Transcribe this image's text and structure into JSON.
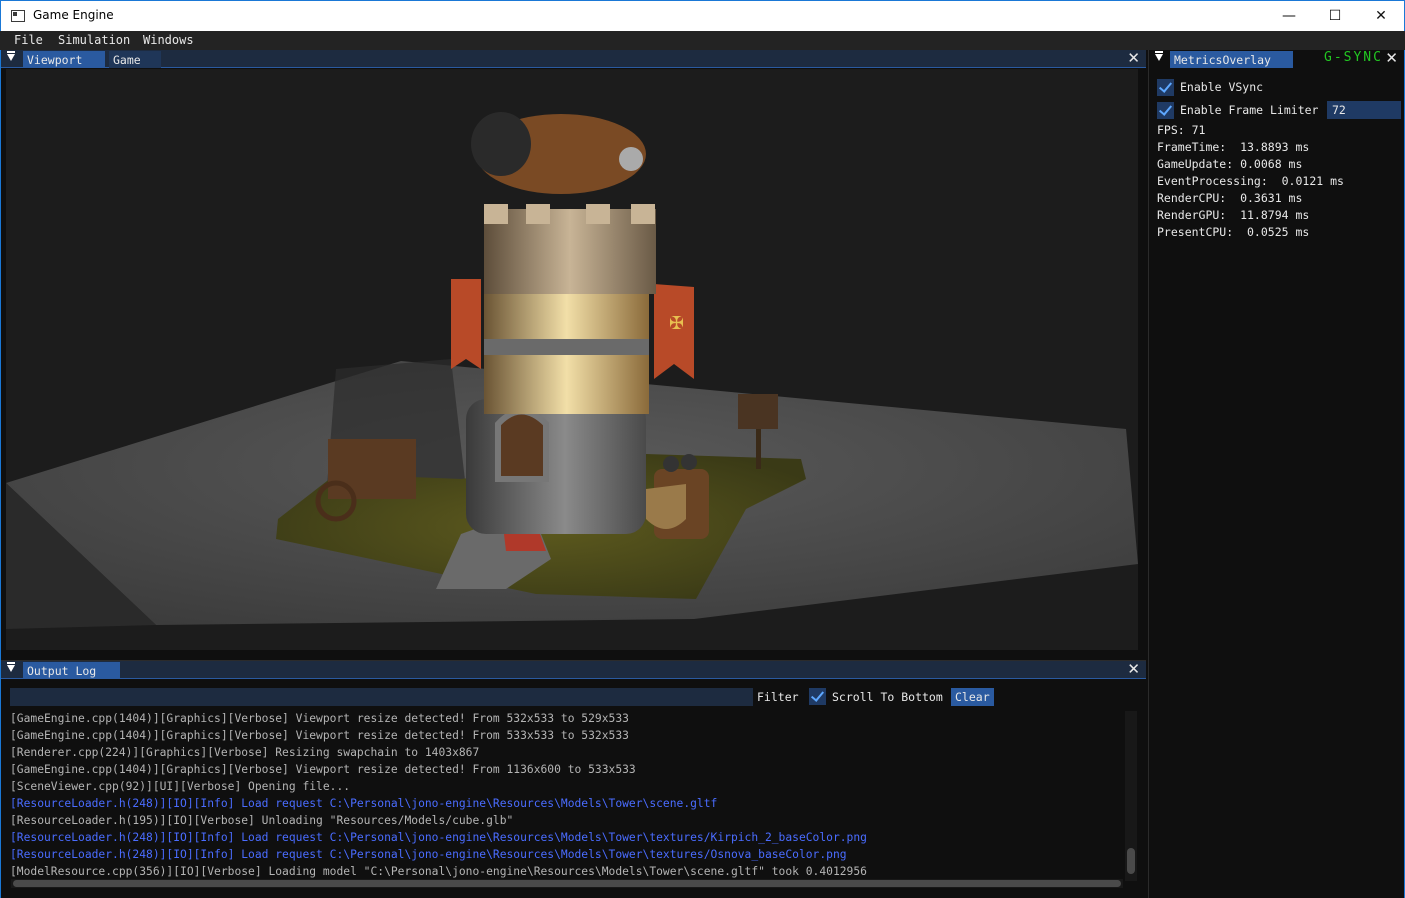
{
  "window": {
    "title": "Game Engine",
    "buttons": {
      "minimize": "—",
      "maximize": "☐",
      "close": "✕"
    }
  },
  "menu": {
    "items": [
      "File",
      "Simulation",
      "Windows"
    ]
  },
  "viewport_panel": {
    "tabs": [
      "Viewport",
      "Game"
    ],
    "active_tab": "Viewport",
    "close": "✕"
  },
  "metrics_panel": {
    "tab": "MetricsOverlay",
    "badge": "G-SYNC",
    "close": "✕",
    "vsync_label": "Enable VSync",
    "vsync_checked": true,
    "frame_limiter_label": "Enable Frame Limiter",
    "frame_limiter_checked": true,
    "frame_limit_value": "72",
    "metrics": [
      "FPS: 71",
      "FrameTime:  13.8893 ms",
      "GameUpdate: 0.0068 ms",
      "EventProcessing:  0.0121 ms",
      "RenderCPU:  0.3631 ms",
      "RenderGPU:  11.8794 ms",
      "PresentCPU:  0.0525 ms"
    ]
  },
  "log_panel": {
    "tab": "Output Log",
    "close": "✕",
    "filter_value": "",
    "filter_label": "Filter",
    "scroll_label": "Scroll To Bottom",
    "scroll_checked": true,
    "clear_label": "Clear",
    "colors": {
      "verbose": "#b4b4b4",
      "info": "#4a6cff"
    },
    "lines": [
      {
        "level": "verbose",
        "text": "[GameEngine.cpp(1404)][Graphics][Verbose] Viewport resize detected! From 532x533 to 529x533"
      },
      {
        "level": "verbose",
        "text": "[GameEngine.cpp(1404)][Graphics][Verbose] Viewport resize detected! From 533x533 to 532x533"
      },
      {
        "level": "verbose",
        "text": "[Renderer.cpp(224)][Graphics][Verbose] Resizing swapchain to 1403x867"
      },
      {
        "level": "verbose",
        "text": "[GameEngine.cpp(1404)][Graphics][Verbose] Viewport resize detected! From 1136x600 to 533x533"
      },
      {
        "level": "verbose",
        "text": "[SceneViewer.cpp(92)][UI][Verbose] Opening file..."
      },
      {
        "level": "info",
        "text": "[ResourceLoader.h(248)][IO][Info] Load request C:\\Personal\\jono-engine\\Resources\\Models\\Tower\\scene.gltf"
      },
      {
        "level": "verbose",
        "text": "[ResourceLoader.h(195)][IO][Verbose] Unloading \"Resources/Models/cube.glb\""
      },
      {
        "level": "info",
        "text": "[ResourceLoader.h(248)][IO][Info] Load request C:\\Personal\\jono-engine\\Resources\\Models\\Tower\\textures/Kirpich_2_baseColor.png"
      },
      {
        "level": "info",
        "text": "[ResourceLoader.h(248)][IO][Info] Load request C:\\Personal\\jono-engine\\Resources\\Models\\Tower\\textures/Osnova_baseColor.png"
      },
      {
        "level": "verbose",
        "text": "[ModelResource.cpp(356)][IO][Verbose] Loading model \"C:\\Personal\\jono-engine\\Resources\\Models\\Tower\\scene.gltf\" took 0.4012956"
      }
    ]
  }
}
